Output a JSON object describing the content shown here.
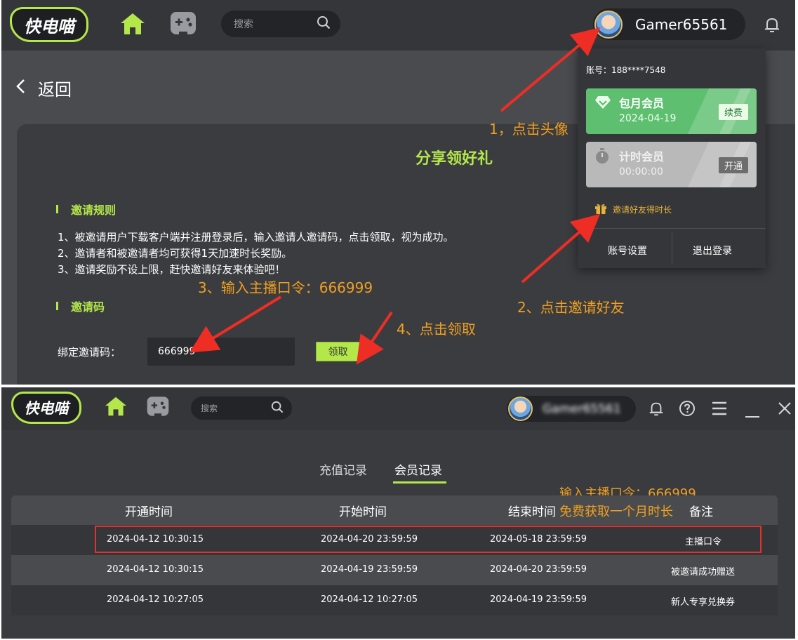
{
  "colors": {
    "accent": "#b4e84a",
    "annotation": "#f0a020",
    "highlight": "#e3322b",
    "monthly_green": "#5dbf6f",
    "timer_gray": "#b9b9b9"
  },
  "top": {
    "logo": "快电喵",
    "search_placeholder": "搜索",
    "username": "Gamer65561",
    "back_label": "返回",
    "title": "分享领好礼",
    "rules_heading": "邀请规则",
    "rules": [
      "1、被邀请用户下载客户端并注册登录后，输入邀请人邀请码，点击领取，视为成功。",
      "2、邀请者和被邀请者均可获得1天加速时长奖励。",
      "3、邀请奖励不设上限，赶快邀请好友来体验吧！"
    ],
    "code_heading": "邀请码",
    "bind_label": "绑定邀请码：",
    "bind_value": "666999",
    "claim_button": "领取",
    "dropdown": {
      "account": "账号：188****7548",
      "monthly_name": "包月会员",
      "monthly_date": "2024-04-19",
      "monthly_button": "续费",
      "timer_name": "计时会员",
      "timer_value": "00:00:00",
      "timer_button": "开通",
      "invite_link": "邀请好友得时长",
      "settings": "账号设置",
      "logout": "退出登录"
    },
    "annotations": {
      "step1": "1，点击头像",
      "step2": "2、点击邀请好友",
      "step3": "3、输入主播口令：666999",
      "step4": "4、点击领取"
    }
  },
  "bottom": {
    "logo": "快电喵",
    "search_placeholder": "搜索",
    "username": "Gamer65561",
    "tabs": [
      "充值记录",
      "会员记录"
    ],
    "annotation_top": "输入主播口令：666999",
    "annotation_bottom": "免费获取一个月时长",
    "headers": [
      "开通时间",
      "开始时间",
      "结束时间",
      "备注"
    ],
    "rows": [
      [
        "2024-04-12 10:30:15",
        "2024-04-20 23:59:59",
        "2024-05-18 23:59:59",
        "主播口令"
      ],
      [
        "2024-04-12 10:30:15",
        "2024-04-19 23:59:59",
        "2024-04-20 23:59:59",
        "被邀请成功赠送"
      ],
      [
        "2024-04-12 10:27:05",
        "2024-04-12 10:27:05",
        "2024-04-19 23:59:59",
        "新人专享兑换券"
      ]
    ]
  }
}
